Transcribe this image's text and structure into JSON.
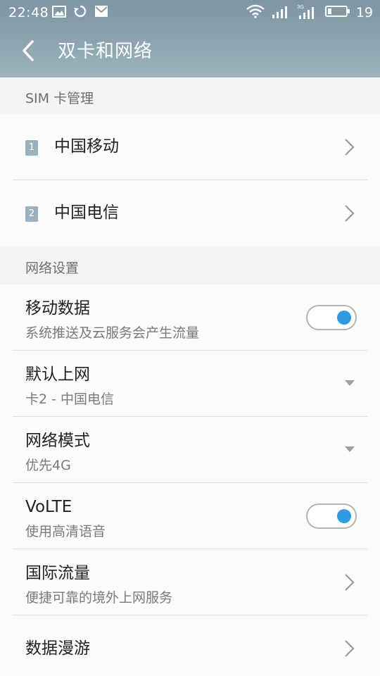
{
  "status_bar": {
    "time": "22:48",
    "battery_level": "19",
    "left_icons": [
      "image-icon",
      "sync-icon",
      "mail-icon"
    ],
    "right_icons": [
      "wifi-icon",
      "signal-icon",
      "3g-signal-icon",
      "battery-icon"
    ]
  },
  "header": {
    "title": "双卡和网络",
    "back_icon": "chevron-left-icon"
  },
  "sim_section": {
    "title": "SIM 卡管理",
    "items": [
      {
        "badge": "1",
        "label": "中国移动"
      },
      {
        "badge": "2",
        "label": "中国电信"
      }
    ]
  },
  "network_section": {
    "title": "网络设置",
    "mobile_data": {
      "title": "移动数据",
      "subtitle": "系统推送及云服务会产生流量",
      "enabled": true
    },
    "default_internet": {
      "title": "默认上网",
      "value": "卡2 - 中国电信"
    },
    "network_mode": {
      "title": "网络模式",
      "value": "优先4G"
    },
    "volte": {
      "title": "VoLTE",
      "subtitle": "使用高清语音",
      "enabled": true
    },
    "intl_data": {
      "title": "国际流量",
      "subtitle": "便捷可靠的境外上网服务"
    },
    "roaming": {
      "title": "数据漫游"
    }
  },
  "colors": {
    "accent": "#2f9be2",
    "header_top": "#7d96a3",
    "header_bottom": "#9fb4ba",
    "sim_badge": "#9cb1bb"
  }
}
